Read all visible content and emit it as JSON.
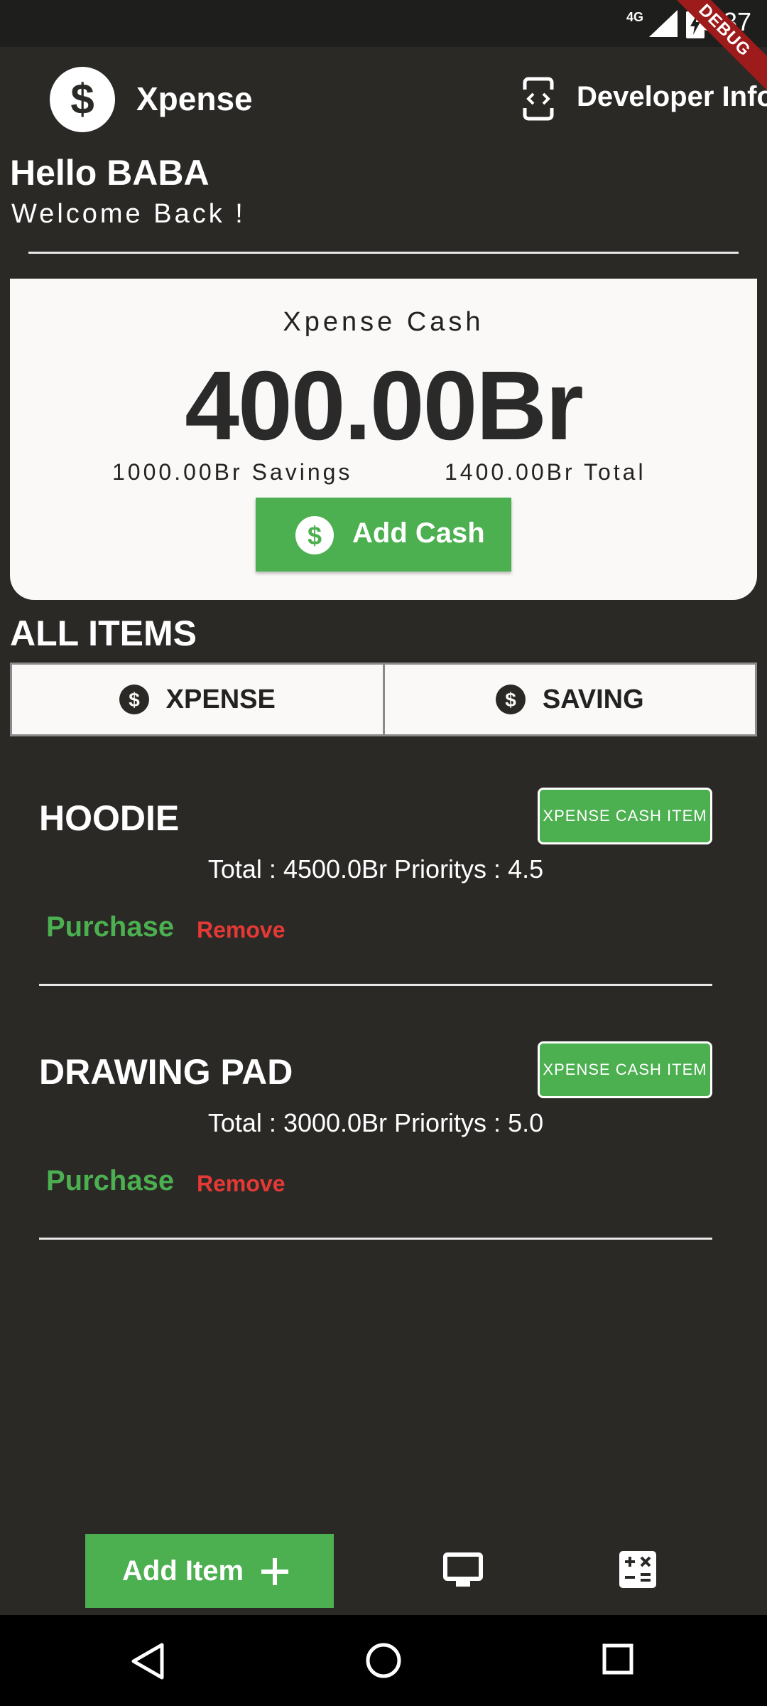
{
  "status_bar": {
    "time": "3:37",
    "network": "4G",
    "debug_label": "DEBUG"
  },
  "app_bar": {
    "title": "Xpense",
    "developer_label": "Developer Info"
  },
  "greeting": {
    "hello": "Hello BABA",
    "welcome": "Welcome Back !"
  },
  "cash_card": {
    "label": "Xpense Cash",
    "amount": "400.00Br",
    "savings": "1000.00Br Savings",
    "total": "1400.00Br Total",
    "add_cash_label": "Add Cash"
  },
  "items_section": {
    "title": "ALL ITEMS",
    "tabs": [
      {
        "label": "XPENSE"
      },
      {
        "label": "SAVING"
      }
    ]
  },
  "items": [
    {
      "name": "HOODIE",
      "badge": "XPENSE CASH ITEM",
      "info": "Total : 4500.0Br Prioritys : 4.5",
      "purchase_label": "Purchase",
      "remove_label": "Remove"
    },
    {
      "name": "DRAWING PAD",
      "badge": "XPENSE CASH ITEM",
      "info": "Total : 3000.0Br Prioritys : 5.0",
      "purchase_label": "Purchase",
      "remove_label": "Remove"
    }
  ],
  "bottom_bar": {
    "add_item_label": "Add Item"
  },
  "colors": {
    "background": "#2a2926",
    "accent_green": "#4caf50",
    "danger_red": "#e53935",
    "card": "#faf9f7"
  }
}
